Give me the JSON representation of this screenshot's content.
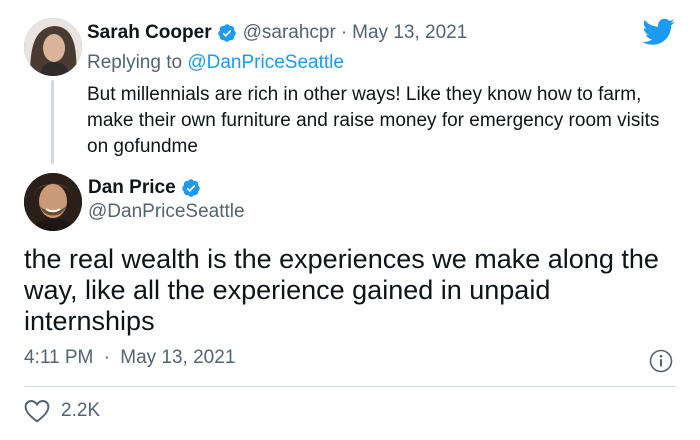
{
  "reply": {
    "name": "Sarah Cooper",
    "handle": "@sarahcpr",
    "separator": "·",
    "date": "May 13, 2021",
    "replying_prefix": "Replying to",
    "replying_mention": "@DanPriceSeattle",
    "text": "But millennials are rich in other ways! Like they know how to farm, make their own furniture and raise money for emergency room visits on gofundme"
  },
  "tweet": {
    "name": "Dan Price",
    "handle": "@DanPriceSeattle",
    "text": "the real wealth is the experiences we make along the way, like all the experience gained in unpaid internships",
    "time": "4:11 PM",
    "separator": "·",
    "date": "May 13, 2021",
    "likes": "2.2K"
  },
  "icons": {
    "brand": "twitter-bird-icon",
    "verified": "verified-badge-icon",
    "info": "info-icon",
    "like": "heart-icon"
  },
  "colors": {
    "accent": "#1d9bf0",
    "secondary_text": "#536471",
    "primary_text": "#0f1419",
    "divider": "#cfd9de"
  }
}
